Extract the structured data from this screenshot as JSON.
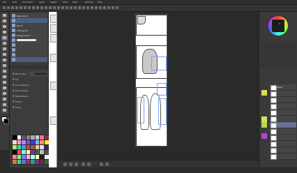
{
  "menu": [
    "File",
    "Edit",
    "Animation",
    "Layer",
    "Select",
    "View",
    "Filter",
    "Window",
    "Help"
  ],
  "subtools": [
    {
      "label": "Real pencil",
      "type": "text",
      "selected": false
    },
    {
      "label": "",
      "type": "text",
      "selected": true
    },
    {
      "label": "Pencil",
      "type": "text",
      "selected": false
    },
    {
      "label": "Soft pencil",
      "type": "text",
      "selected": false
    },
    {
      "label": "Rough pencil",
      "type": "text",
      "selected": false
    },
    {
      "label": "",
      "type": "stroke",
      "selected": false
    },
    {
      "label": "",
      "type": "text",
      "selected": false
    },
    {
      "label": "",
      "type": "text",
      "selected": false
    },
    {
      "label": "",
      "type": "text",
      "selected": false
    },
    {
      "label": "",
      "type": "text",
      "selected": true
    }
  ],
  "tool_property": {
    "rows": [
      {
        "label": "Brush size",
        "value": "3.0"
      },
      {
        "label": "Ink",
        "value": ""
      },
      {
        "label": "Anti-aliasing",
        "value": ""
      },
      {
        "label": "Brush shape",
        "value": ""
      },
      {
        "label": "Stabilization",
        "value": ""
      },
      {
        "label": "Vector",
        "value": ""
      },
      {
        "label": "Snap",
        "value": ""
      }
    ]
  },
  "swatches": [
    "#000000",
    "#ffffff",
    "#5a5a5a",
    "#888888",
    "#b0b0b0",
    "#d0d0d0",
    "#ff6ea0",
    "#8b2b4b",
    "#ffd1e0",
    "#f0a0c0",
    "#c080ff",
    "#7b4bd6",
    "#3b3bd6",
    "#7bc0ff",
    "#ff9a3b",
    "#ffe13b",
    "#9bff5b",
    "#3bd6a0",
    "#3ba0d6",
    "#d63b3b",
    "#a05b3b",
    "#ffc3a0",
    "#e0e0ff",
    "#2b2b6b",
    "#000000",
    "#ff3b7b",
    "#7bffd6",
    "#ffff9b",
    "#6b3b8b",
    "#3b6b3b",
    "#c0c0c0",
    "#505050",
    "#ff8080",
    "#80ff80",
    "#8080ff",
    "#ffb0ff",
    "#b0ffff",
    "#ffffb0",
    "#202020",
    "#f0f0f0",
    "#d08050",
    "#50d080",
    "#5080d0",
    "#a03080",
    "#30a080",
    "#8030a0",
    "#703030",
    "#307030"
  ],
  "layers": [
    {
      "label": "Paper",
      "selected": false
    },
    {
      "label": "",
      "selected": false
    },
    {
      "label": "",
      "selected": false
    },
    {
      "label": "",
      "selected": false
    },
    {
      "label": "",
      "selected": false
    },
    {
      "label": "",
      "selected": false
    },
    {
      "label": "",
      "selected": true
    },
    {
      "label": "",
      "selected": false
    },
    {
      "label": "",
      "selected": false
    },
    {
      "label": "",
      "selected": false
    },
    {
      "label": "",
      "selected": false
    },
    {
      "label": "",
      "selected": false
    }
  ],
  "colors": {
    "accent": "#5b6b8a",
    "selection": "#6a6f93",
    "guide": "#6fa2ff"
  }
}
